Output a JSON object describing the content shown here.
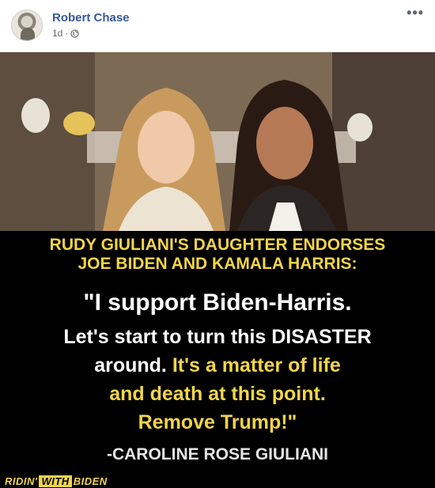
{
  "post": {
    "author": "Robert Chase",
    "time": "1d",
    "separator": "·",
    "privacy_icon": "globe-icon",
    "more_icon": "more-options-icon",
    "more_label": "•••"
  },
  "meme": {
    "headline_line1": "RUDY GIULIANI'S DAUGHTER ENDORSES",
    "headline_line2": "JOE BIDEN AND KAMALA HARRIS:",
    "quote_line1": "\"I support Biden-Harris.",
    "quote_line2_white": "Let's start to turn this DISASTER",
    "quote_line3_white": "around.",
    "quote_line3_yellow": "It's a matter of life",
    "quote_line4_yellow": "and death at this point.",
    "quote_line5_yellow": "Remove Trump!\"",
    "byline": "-CAROLINE ROSE GIULIANI",
    "watermark_pre": "RIDIN'",
    "watermark_box": "WITH",
    "watermark_post": "BIDEN",
    "accent_color": "#f2d54a"
  }
}
